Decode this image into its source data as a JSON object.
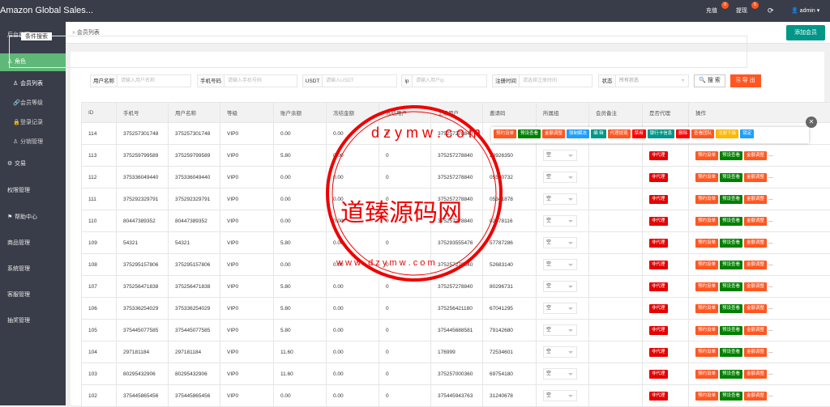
{
  "topbar": {
    "brand": "Amazon Global Sales...",
    "recharge": "充值",
    "recharge_badge": "0",
    "withdraw": "提现",
    "withdraw_badge": "5",
    "user": "admin"
  },
  "sidebar": {
    "items": [
      {
        "label": "后台首页"
      },
      {
        "label": "角色"
      },
      {
        "label": "会员列表"
      },
      {
        "label": "会员等级"
      },
      {
        "label": "登录记录"
      },
      {
        "label": "分销管理"
      },
      {
        "label": "交易"
      },
      {
        "label": "权限管理"
      },
      {
        "label": "帮助中心"
      },
      {
        "label": "商品管理"
      },
      {
        "label": "系统管理"
      },
      {
        "label": "客服管理"
      },
      {
        "label": "抽奖管理"
      }
    ]
  },
  "breadcrumb": "会员列表",
  "add_button": "添加会员",
  "filter": {
    "legend": "条件搜索",
    "fields": [
      {
        "label": "用户名称",
        "placeholder": "请输入用户名称"
      },
      {
        "label": "手机号码",
        "placeholder": "请输入手机号码"
      },
      {
        "label": "USDT",
        "placeholder": "请输入USDT"
      },
      {
        "label": "ip",
        "placeholder": "请输入用户ip"
      },
      {
        "label": "注册时间",
        "placeholder": "请选择注册时间"
      },
      {
        "label": "状态",
        "placeholder": "所有状态"
      }
    ],
    "search": "搜 索",
    "export": "导 出"
  },
  "table": {
    "headers": [
      "ID",
      "手机号",
      "用户名称",
      "等级",
      "账户余额",
      "冻结金额",
      "冻结用户",
      "上级用户",
      "邀请码",
      "所属组",
      "会员备注",
      "是否代理",
      "操作"
    ],
    "rows": [
      [
        "114",
        "375257301748",
        "375257301748",
        "VIP0",
        "0.00",
        "0.00",
        "0",
        "375257278840",
        "",
        "",
        "",
        "",
        ""
      ],
      [
        "113",
        "375259799589",
        "375259799589",
        "VIP0",
        "5.80",
        "0.00",
        "0",
        "375257278840",
        "23926350",
        "空",
        "",
        "非代理",
        "..."
      ],
      [
        "112",
        "375336049440",
        "375336049440",
        "VIP0",
        "0.00",
        "0.00",
        "0",
        "375257278840",
        "05580732",
        "空",
        "",
        "非代理",
        "..."
      ],
      [
        "111",
        "375292329791",
        "375292329791",
        "VIP0",
        "0.00",
        "0.00",
        "0",
        "375257278840",
        "05341878",
        "空",
        "",
        "非代理",
        "..."
      ],
      [
        "110",
        "80447389352",
        "80447389352",
        "VIP0",
        "0.00",
        "0.00",
        "0",
        "375257278840",
        "02878116",
        "空",
        "",
        "非代理",
        "..."
      ],
      [
        "109",
        "54321",
        "54321",
        "VIP0",
        "5.80",
        "0.00",
        "0",
        "375293555476",
        "57787286",
        "空",
        "",
        "非代理",
        "..."
      ],
      [
        "108",
        "375295157806",
        "375295157806",
        "VIP0",
        "0.00",
        "0.00",
        "0",
        "375257278840",
        "52683140",
        "空",
        "",
        "非代理",
        "..."
      ],
      [
        "107",
        "375256471838",
        "375256471838",
        "VIP0",
        "5.80",
        "0.00",
        "0",
        "375257278840",
        "80296731",
        "空",
        "",
        "非代理",
        "..."
      ],
      [
        "106",
        "375336254029",
        "375336254029",
        "VIP0",
        "5.80",
        "0.00",
        "0",
        "375256421180",
        "67041295",
        "空",
        "",
        "非代理",
        "..."
      ],
      [
        "105",
        "375445077585",
        "375445077585",
        "VIP0",
        "5.80",
        "0.00",
        "0",
        "375445688581",
        "79142680",
        "空",
        "",
        "非代理",
        "..."
      ],
      [
        "104",
        "297181184",
        "297181184",
        "VIP0",
        "11.60",
        "0.00",
        "0",
        "176999",
        "72534601",
        "空",
        "",
        "非代理",
        "..."
      ],
      [
        "103",
        "80295432906",
        "80295432906",
        "VIP0",
        "11.60",
        "0.00",
        "0",
        "375257000360",
        "69754180",
        "空",
        "",
        "非代理",
        "..."
      ],
      [
        "102",
        "375445865456",
        "375445865456",
        "VIP0",
        "0.00",
        "0.00",
        "0",
        "375445943763",
        "31240678",
        "空",
        "",
        "非代理",
        "..."
      ]
    ]
  },
  "row_actions": [
    "预约设单",
    "预设查看",
    "金额调整"
  ],
  "popup_actions": [
    "预约设单",
    "预设查看",
    "金额调整",
    "强制解冻",
    "编 辑",
    "代理提现",
    "禁用",
    "银行卡信息",
    "删除",
    "查看团队",
    "注册下级",
    "锁定"
  ],
  "watermark": {
    "top": "d z y m w . c o m",
    "bottom": "w w w . d z y m w . c o m",
    "center": "道臻源码网"
  }
}
